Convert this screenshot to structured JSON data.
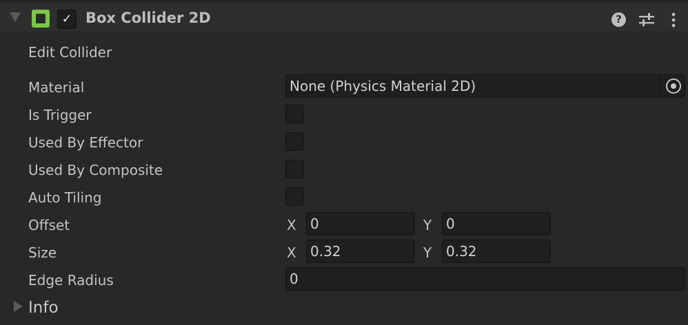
{
  "header": {
    "title": "Box Collider 2D",
    "enabled_check": "✓",
    "help_glyph": "?",
    "icons": [
      "box-collider-icon",
      "help-icon",
      "presets-icon",
      "kebab-menu-icon"
    ],
    "accent_color": "#7dc646"
  },
  "edit_collider": {
    "label": "Edit Collider"
  },
  "material": {
    "label": "Material",
    "value": "None (Physics Material 2D)"
  },
  "is_trigger": {
    "label": "Is Trigger",
    "checked": false
  },
  "used_by_effector": {
    "label": "Used By Effector",
    "checked": false
  },
  "used_by_composite": {
    "label": "Used By Composite",
    "checked": false
  },
  "auto_tiling": {
    "label": "Auto Tiling",
    "checked": false
  },
  "offset": {
    "label": "Offset",
    "x_label": "X",
    "x_value": "0",
    "y_label": "Y",
    "y_value": "0"
  },
  "size": {
    "label": "Size",
    "x_label": "X",
    "x_value": "0.32",
    "y_label": "Y",
    "y_value": "0.32"
  },
  "edge_radius": {
    "label": "Edge Radius",
    "value": "0"
  },
  "info": {
    "label": "Info"
  }
}
